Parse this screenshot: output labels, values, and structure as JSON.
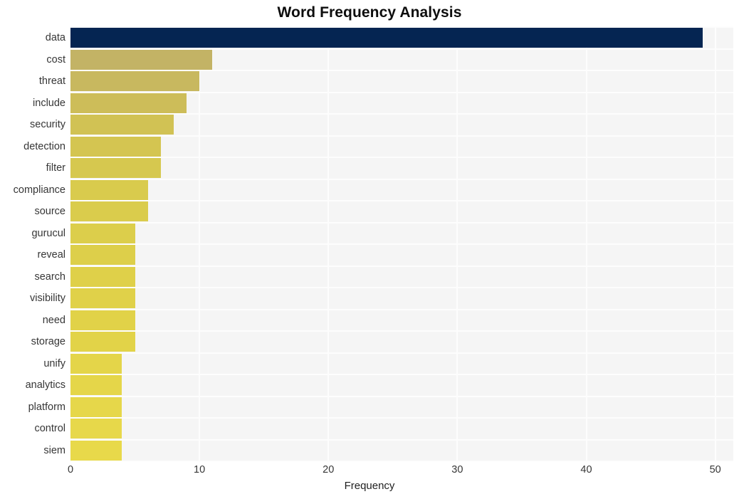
{
  "chart_data": {
    "type": "bar",
    "orientation": "horizontal",
    "title": "Word Frequency Analysis",
    "xlabel": "Frequency",
    "ylabel": "",
    "categories": [
      "data",
      "cost",
      "threat",
      "include",
      "security",
      "detection",
      "filter",
      "compliance",
      "source",
      "gurucul",
      "reveal",
      "search",
      "visibility",
      "need",
      "storage",
      "unify",
      "analytics",
      "platform",
      "control",
      "siem"
    ],
    "values": [
      49,
      11,
      10,
      9,
      8,
      7,
      7,
      6,
      6,
      5,
      5,
      5,
      5,
      5,
      5,
      4,
      4,
      4,
      4,
      4
    ],
    "bar_colors": [
      "#052552",
      "#c3b365",
      "#c8b85f",
      "#cdbd59",
      "#d1c254",
      "#d4c551",
      "#d6c84f",
      "#d9cb4d",
      "#dacc4c",
      "#dcce4b",
      "#ddcf4a",
      "#dfd049",
      "#e0d149",
      "#e1d248",
      "#e2d348",
      "#e4d549",
      "#e5d649",
      "#e6d74a",
      "#e7d84a",
      "#e8d94a"
    ],
    "xlim": [
      0,
      51.4
    ],
    "xticks": [
      0,
      10,
      20,
      30,
      40,
      50
    ],
    "xticklabels": [
      "0",
      "10",
      "20",
      "30",
      "40",
      "50"
    ],
    "grid": true,
    "grid_color": "#fdfdfd",
    "plot_background": "#f5f5f5",
    "figure_background": "#ffffff",
    "legend": null,
    "accent_color": "#052552",
    "highlight_color": "#e8d94a"
  }
}
